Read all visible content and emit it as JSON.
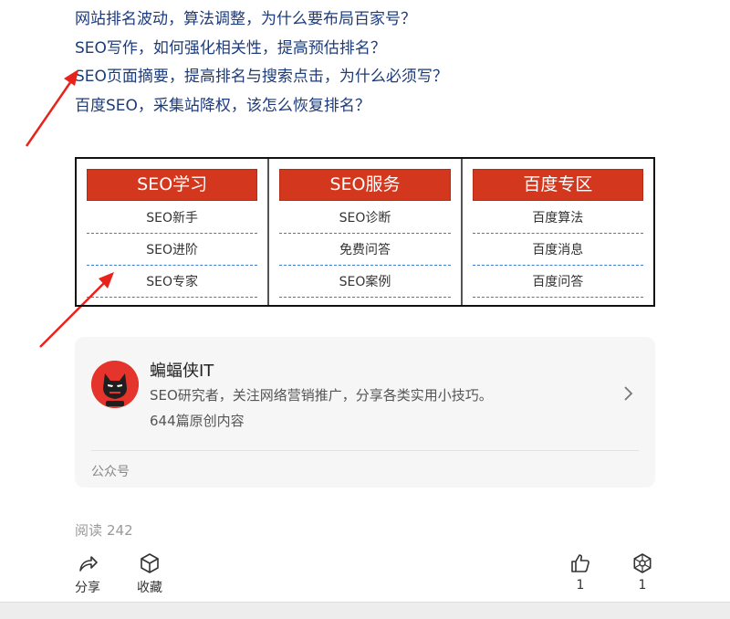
{
  "related_links": [
    "网站排名波动，算法调整，为什么要布局百家号？",
    "SEO写作，如何强化相关性，提高预估排名？",
    "SEO页面摘要，提高排名与搜索点击，为什么必须写？",
    "百度SEO，采集站降权，该怎么恢复排名？"
  ],
  "categories": [
    {
      "title": "SEO学习",
      "items": [
        "SEO新手",
        "SEO进阶",
        "SEO专家"
      ]
    },
    {
      "title": "SEO服务",
      "items": [
        "SEO诊断",
        "免费问答",
        "SEO案例"
      ]
    },
    {
      "title": "百度专区",
      "items": [
        "百度算法",
        "百度消息",
        "百度问答"
      ]
    }
  ],
  "account": {
    "name": "蝙蝠侠IT",
    "description": "SEO研究者，关注网络营销推广，分享各类实用小技巧。",
    "article_count": "644篇原创内容",
    "type_label": "公众号"
  },
  "stats": {
    "read_label": "阅读",
    "read_count": "242"
  },
  "actions": {
    "share_label": "分享",
    "favorite_label": "收藏",
    "like_count": "1",
    "wow_count": "1"
  },
  "colors": {
    "link": "#1d3b7a",
    "category_header": "#d3371e",
    "dashed_divider": "#3d7bd1",
    "annotation_arrow": "#e8231b",
    "avatar_bg": "#e5342b"
  },
  "icons": {
    "share": "share-icon",
    "favorite": "cube-icon",
    "like": "thumbs-up-icon",
    "wow": "wow-icon",
    "chevron": "chevron-right-icon"
  }
}
